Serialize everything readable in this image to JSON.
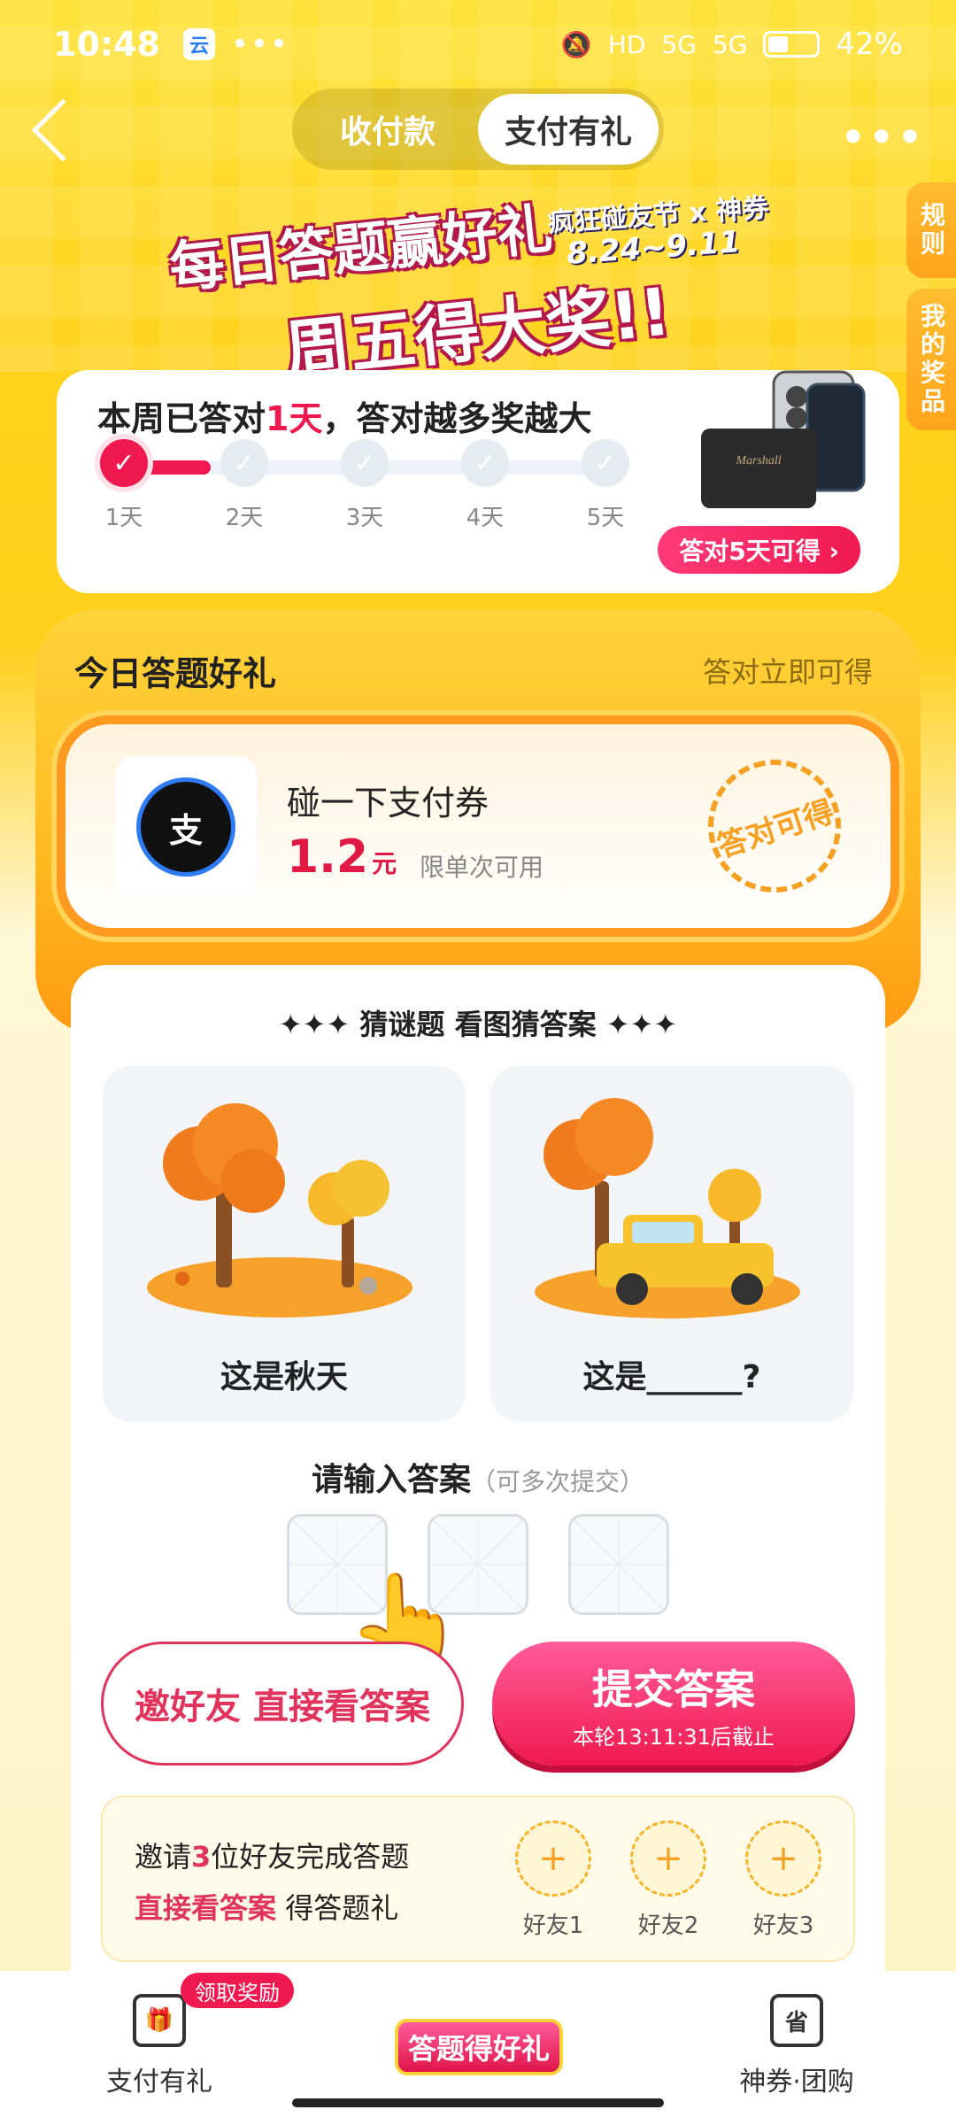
{
  "status": {
    "time": "10:48",
    "app_badge": "云",
    "dots": "•••",
    "hd": "HD",
    "net1": "5G",
    "net2": "5G",
    "battery": "42%"
  },
  "nav": {
    "tabs": [
      "收付款",
      "支付有礼"
    ],
    "active_tab": 1
  },
  "side_tabs": [
    "规则",
    "我的奖品"
  ],
  "banner": {
    "line1": "每日答题赢好礼",
    "line2": "周五得大奖!!",
    "tag": "疯狂碰友节 x 神券",
    "date": "8.24~9.11"
  },
  "progress": {
    "title_prefix": "本周已答对",
    "title_days": "1天",
    "title_suffix": "，答对越多奖越大",
    "days_done": 1,
    "steps": [
      "1天",
      "2天",
      "3天",
      "4天",
      "5天"
    ],
    "prize_label": "答对5天可得 ›",
    "prize_brand": "Marshall"
  },
  "reward": {
    "title": "今日答题好礼",
    "subtitle": "答对立即可得",
    "coupon_logo": "支",
    "coupon_name": "碰一下支付券",
    "amount": "1.2",
    "unit": "元",
    "note": "限单次可用",
    "stamp": "答对可得"
  },
  "quiz": {
    "title": "✦✦✦ 猜谜题 看图猜答案 ✦✦✦",
    "pic1_caption": "这是秋天",
    "pic2_caption": "这是______?",
    "answer_title": "请输入答案",
    "answer_hint": "（可多次提交）",
    "invite_button": "邀好友 直接看答案",
    "submit_button": "提交答案",
    "submit_deadline": "本轮13:11:31后截止",
    "invite_line1_a": "邀请",
    "invite_line1_num": "3",
    "invite_line1_b": "位好友完成答题",
    "invite_line2_a": "直接看答案",
    "invite_line2_b": " 得答题礼",
    "friends": [
      "好友1",
      "好友2",
      "好友3"
    ],
    "plus": "+"
  },
  "tabbar": {
    "left_label": "支付有礼",
    "left_badge": "领取奖励",
    "center_label": "答题得好礼",
    "right_label": "神券·团购",
    "right_icon": "省"
  },
  "colors": {
    "accent": "#f0194f",
    "yellow": "#ffd21c",
    "orange": "#ffa41b"
  }
}
